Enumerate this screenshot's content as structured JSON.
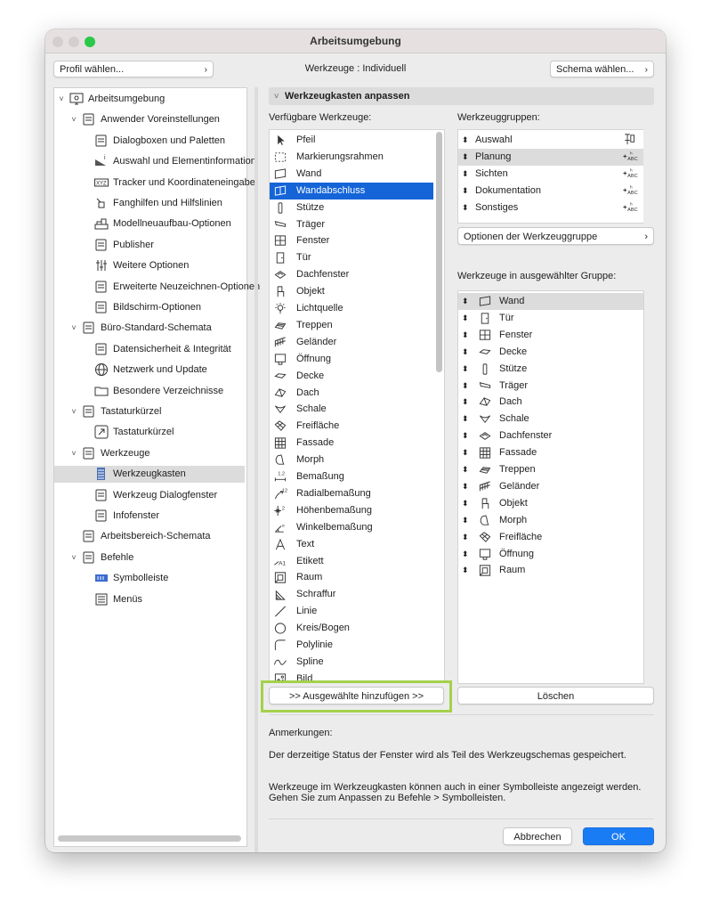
{
  "window": {
    "title": "Arbeitsumgebung"
  },
  "topbar": {
    "profile_label": "Profil wählen...",
    "center_label": "Werkzeuge : Individuell",
    "scheme_label": "Schema wählen..."
  },
  "tree": [
    {
      "label": "Arbeitsumgebung",
      "level": 0,
      "disc": "˅",
      "icon": "monitor-icon"
    },
    {
      "label": "Anwender Voreinstellungen",
      "level": 1,
      "disc": "˅",
      "icon": "user-settings-icon"
    },
    {
      "label": "Dialogboxen und Paletten",
      "level": 2,
      "icon": "dialog-palette-icon"
    },
    {
      "label": "Auswahl und Elementinformation",
      "level": 2,
      "icon": "selection-info-icon"
    },
    {
      "label": "Tracker und Koordinateneingabe",
      "level": 2,
      "icon": "xyz-tracker-icon"
    },
    {
      "label": "Fanghilfen und Hilfslinien",
      "level": 2,
      "icon": "snap-guides-icon"
    },
    {
      "label": "Modellneuaufbau-Optionen",
      "level": 2,
      "icon": "model-rebuild-icon"
    },
    {
      "label": "Publisher",
      "level": 2,
      "icon": "publisher-icon"
    },
    {
      "label": "Weitere Optionen",
      "level": 2,
      "icon": "more-options-icon"
    },
    {
      "label": "Erweiterte Neuzeichnen-Optionen",
      "level": 2,
      "icon": "redraw-options-icon"
    },
    {
      "label": "Bildschirm-Optionen",
      "level": 2,
      "icon": "screen-options-icon"
    },
    {
      "label": "Büro-Standard-Schemata",
      "level": 1,
      "disc": "˅",
      "icon": "office-schemes-icon"
    },
    {
      "label": "Datensicherheit & Integrität",
      "level": 2,
      "icon": "data-safety-icon"
    },
    {
      "label": "Netzwerk und Update",
      "level": 2,
      "icon": "globe-icon"
    },
    {
      "label": "Besondere Verzeichnisse",
      "level": 2,
      "icon": "folder-icon"
    },
    {
      "label": "Tastaturkürzel",
      "level": 1,
      "disc": "˅",
      "icon": "keyboard-scheme-icon"
    },
    {
      "label": "Tastaturkürzel",
      "level": 2,
      "icon": "shortcut-icon"
    },
    {
      "label": "Werkzeuge",
      "level": 1,
      "disc": "˅",
      "icon": "tools-scheme-icon"
    },
    {
      "label": "Werkzeugkasten",
      "level": 2,
      "icon": "toolbox-icon",
      "selected": true
    },
    {
      "label": "Werkzeug Dialogfenster",
      "level": 2,
      "icon": "tool-dialog-icon"
    },
    {
      "label": "Infofenster",
      "level": 2,
      "icon": "info-window-icon"
    },
    {
      "label": "Arbeitsbereich-Schemata",
      "level": 1,
      "icon": "workspace-schemes-icon"
    },
    {
      "label": "Befehle",
      "level": 1,
      "disc": "˅",
      "icon": "commands-scheme-icon"
    },
    {
      "label": "Symbolleiste",
      "level": 2,
      "icon": "toolbar-icon"
    },
    {
      "label": "Menüs",
      "level": 2,
      "icon": "menus-icon"
    }
  ],
  "section": {
    "title": "Werkzeugkasten anpassen"
  },
  "available": {
    "label": "Verfügbare Werkzeuge:",
    "items": [
      {
        "label": "Pfeil",
        "icon": "arrow-icon"
      },
      {
        "label": "Markierungsrahmen",
        "icon": "marquee-icon"
      },
      {
        "label": "Wand",
        "icon": "wall-icon"
      },
      {
        "label": "Wandabschluss",
        "icon": "curtain-wall-icon",
        "selected": true
      },
      {
        "label": "Stütze",
        "icon": "column-icon"
      },
      {
        "label": "Träger",
        "icon": "beam-icon"
      },
      {
        "label": "Fenster",
        "icon": "window-icon"
      },
      {
        "label": "Tür",
        "icon": "door-icon"
      },
      {
        "label": "Dachfenster",
        "icon": "skylight-icon"
      },
      {
        "label": "Objekt",
        "icon": "object-icon"
      },
      {
        "label": "Lichtquelle",
        "icon": "lamp-icon"
      },
      {
        "label": "Treppen",
        "icon": "stair-icon"
      },
      {
        "label": "Geländer",
        "icon": "railing-icon"
      },
      {
        "label": "Öffnung",
        "icon": "opening-icon"
      },
      {
        "label": "Decke",
        "icon": "slab-icon"
      },
      {
        "label": "Dach",
        "icon": "roof-icon"
      },
      {
        "label": "Schale",
        "icon": "shell-icon"
      },
      {
        "label": "Freifläche",
        "icon": "mesh-icon"
      },
      {
        "label": "Fassade",
        "icon": "curtain-icon"
      },
      {
        "label": "Morph",
        "icon": "morph-icon"
      },
      {
        "label": "Bemaßung",
        "icon": "dimension-icon"
      },
      {
        "label": "Radialbemaßung",
        "icon": "radial-dimension-icon"
      },
      {
        "label": "Höhenbemaßung",
        "icon": "level-dimension-icon"
      },
      {
        "label": "Winkelbemaßung",
        "icon": "angle-dimension-icon"
      },
      {
        "label": "Text",
        "icon": "text-icon"
      },
      {
        "label": "Etikett",
        "icon": "label-icon"
      },
      {
        "label": "Raum",
        "icon": "zone-icon"
      },
      {
        "label": "Schraffur",
        "icon": "fill-icon"
      },
      {
        "label": "Linie",
        "icon": "line-icon"
      },
      {
        "label": "Kreis/Bogen",
        "icon": "circle-icon"
      },
      {
        "label": "Polylinie",
        "icon": "polyline-icon"
      },
      {
        "label": "Spline",
        "icon": "spline-icon"
      },
      {
        "label": "Bild",
        "icon": "image-icon"
      }
    ]
  },
  "groups": {
    "label": "Werkzeuggruppen:",
    "items": [
      {
        "label": "Auswahl",
        "icon": "pin-icon"
      },
      {
        "label": "Planung",
        "icon": "abc-display-icon",
        "highlight": true
      },
      {
        "label": "Sichten",
        "icon": "abc-display-icon"
      },
      {
        "label": "Dokumentation",
        "icon": "abc-display-icon"
      },
      {
        "label": "Sonstiges",
        "icon": "abc-display-icon"
      }
    ],
    "options_label": "Optionen der Werkzeuggruppe"
  },
  "in_group": {
    "label": "Werkzeuge in ausgewählter Gruppe:",
    "items": [
      {
        "label": "Wand",
        "icon": "wall-icon",
        "highlight": true
      },
      {
        "label": "Tür",
        "icon": "door-icon"
      },
      {
        "label": "Fenster",
        "icon": "window-icon"
      },
      {
        "label": "Decke",
        "icon": "slab-icon"
      },
      {
        "label": "Stütze",
        "icon": "column-icon"
      },
      {
        "label": "Träger",
        "icon": "beam-icon"
      },
      {
        "label": "Dach",
        "icon": "roof-icon"
      },
      {
        "label": "Schale",
        "icon": "shell-icon"
      },
      {
        "label": "Dachfenster",
        "icon": "skylight-icon"
      },
      {
        "label": "Fassade",
        "icon": "curtain-icon"
      },
      {
        "label": "Treppen",
        "icon": "stair-icon"
      },
      {
        "label": "Geländer",
        "icon": "railing-icon"
      },
      {
        "label": "Objekt",
        "icon": "object-icon"
      },
      {
        "label": "Morph",
        "icon": "morph-icon"
      },
      {
        "label": "Freifläche",
        "icon": "mesh-icon"
      },
      {
        "label": "Öffnung",
        "icon": "opening-icon"
      },
      {
        "label": "Raum",
        "icon": "zone-icon"
      }
    ]
  },
  "buttons": {
    "add": ">> Ausgewählte hinzufügen >>",
    "delete": "Löschen",
    "cancel": "Abbrechen",
    "ok": "OK"
  },
  "notes": {
    "heading": "Anmerkungen:",
    "line1": "Der derzeitige Status der Fenster wird als Teil des Werkzeugschemas gespeichert.",
    "line2": "Werkzeuge im Werkzeugkasten können auch in einer Symbolleiste angezeigt werden.",
    "line3": "Gehen Sie zum Anpassen zu Befehle > Symbolleisten."
  },
  "colors": {
    "accent": "#1565d8",
    "ok_button": "#1a7cf5",
    "highlight_box": "#a4d14b",
    "traffic_green": "#2bc84a"
  }
}
